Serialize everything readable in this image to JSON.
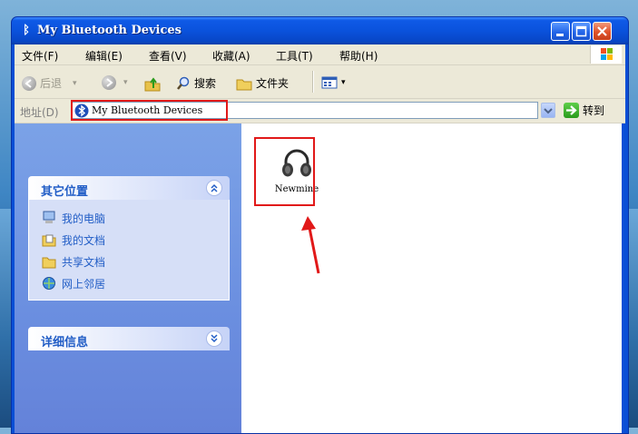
{
  "window": {
    "title": "My Bluetooth Devices",
    "controls": [
      "minimize",
      "maximize",
      "close"
    ]
  },
  "menubar": {
    "items": [
      "文件(F)",
      "编辑(E)",
      "查看(V)",
      "收藏(A)",
      "工具(T)",
      "帮助(H)"
    ]
  },
  "toolbar": {
    "back_label": "后退",
    "search_label": "搜索",
    "folders_label": "文件夹"
  },
  "address": {
    "label": "地址(D)",
    "value": "My Bluetooth Devices",
    "go_label": "转到"
  },
  "taskpane": {
    "other_places": {
      "title": "其它位置",
      "links": [
        "我的电脑",
        "我的文档",
        "共享文档",
        "网上邻居"
      ]
    },
    "details": {
      "title": "详细信息"
    }
  },
  "files": {
    "items": [
      {
        "label": "Newmine",
        "icon": "headphones-icon"
      }
    ]
  },
  "colors": {
    "annotation_red": "#e11919",
    "xp_blue": "#0a4fd6",
    "link_blue": "#215dc6"
  }
}
